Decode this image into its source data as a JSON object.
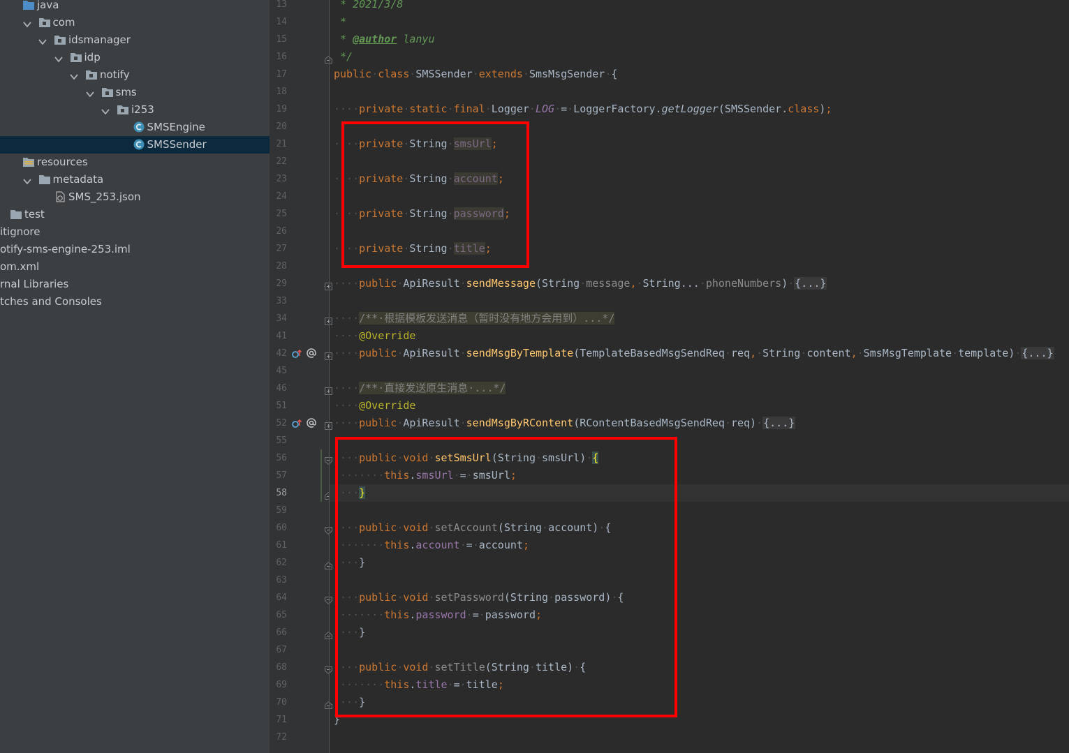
{
  "colors": {
    "tree_background": "#3c3f41",
    "tree_selected": "#0d293e",
    "editor_background": "#2b2b2b",
    "keyword": "#cc7832",
    "field": "#9876aa",
    "method": "#ffc66d",
    "annotation": "#bbb529",
    "doc_comment": "#629755",
    "highlight_box": "#ff0000"
  },
  "tree": {
    "items": [
      {
        "label": "java",
        "icon": "source-folder-icon",
        "arrow": false,
        "indent": 0
      },
      {
        "label": "com",
        "icon": "package-icon",
        "arrow": true,
        "indent": 1
      },
      {
        "label": "idsmanager",
        "icon": "package-icon",
        "arrow": true,
        "indent": 2
      },
      {
        "label": "idp",
        "icon": "package-icon",
        "arrow": true,
        "indent": 3
      },
      {
        "label": "notify",
        "icon": "package-icon",
        "arrow": true,
        "indent": 4
      },
      {
        "label": "sms",
        "icon": "package-icon",
        "arrow": true,
        "indent": 5
      },
      {
        "label": "i253",
        "icon": "package-icon",
        "arrow": true,
        "indent": 6
      },
      {
        "label": "SMSEngine",
        "icon": "java-class-icon",
        "arrow": false,
        "indent": 7
      },
      {
        "label": "SMSSender",
        "icon": "java-class-icon",
        "arrow": false,
        "indent": 7,
        "selected": true
      },
      {
        "label": "resources",
        "icon": "resources-folder-icon",
        "arrow": false,
        "indent": 0
      },
      {
        "label": "metadata",
        "icon": "folder-icon",
        "arrow": true,
        "indent": 1
      },
      {
        "label": "SMS_253.json",
        "icon": "json-file-icon",
        "arrow": false,
        "indent": 2
      },
      {
        "label": "test",
        "icon": "folder-icon",
        "arrow": false,
        "indent": -1
      },
      {
        "label": "itignore",
        "icon": "",
        "arrow": false,
        "indent": -2
      },
      {
        "label": "otify-sms-engine-253.iml",
        "icon": "",
        "arrow": false,
        "indent": -2
      },
      {
        "label": "om.xml",
        "icon": "",
        "arrow": false,
        "indent": -2
      },
      {
        "label": "rnal Libraries",
        "icon": "",
        "arrow": false,
        "indent": -2
      },
      {
        "label": "tches and Consoles",
        "icon": "",
        "arrow": false,
        "indent": -2
      }
    ]
  },
  "editor": {
    "current_line": "58",
    "lines": [
      {
        "n": "13",
        "tokens": [
          [
            "cm",
            " * 2021/3/8"
          ]
        ]
      },
      {
        "n": "14",
        "tokens": [
          [
            "cm",
            " *"
          ]
        ]
      },
      {
        "n": "15",
        "tokens": [
          [
            "cm",
            " * "
          ],
          [
            "tag",
            "@author"
          ],
          [
            "cm",
            " lanyu"
          ]
        ]
      },
      {
        "n": "16",
        "tokens": [
          [
            "cm",
            " */"
          ]
        ],
        "fold": "end"
      },
      {
        "n": "17",
        "tokens": [
          [
            "kw",
            "public"
          ],
          [
            "dot",
            "·"
          ],
          [
            "kw",
            "class"
          ],
          [
            "dot",
            "·"
          ],
          [
            "",
            "SMSSender"
          ],
          [
            "dot",
            "·"
          ],
          [
            "kw",
            "extends"
          ],
          [
            "dot",
            "·"
          ],
          [
            "",
            "SmsMsgSender"
          ],
          [
            "dot",
            "·"
          ],
          [
            "",
            "{"
          ]
        ]
      },
      {
        "n": "18",
        "tokens": []
      },
      {
        "n": "19",
        "tokens": [
          [
            "dot",
            "····"
          ],
          [
            "kw",
            "private"
          ],
          [
            "dot",
            "·"
          ],
          [
            "kw",
            "static"
          ],
          [
            "dot",
            "·"
          ],
          [
            "kw",
            "final"
          ],
          [
            "dot",
            "·"
          ],
          [
            "",
            "Logger"
          ],
          [
            "dot",
            "·"
          ],
          [
            "fld-i",
            "LOG"
          ],
          [
            "dot",
            "·"
          ],
          [
            "",
            "="
          ],
          [
            "dot",
            "·"
          ],
          [
            "",
            "LoggerFactory."
          ],
          [
            "fn-i",
            "getLogger"
          ],
          [
            "",
            "(SMSSender."
          ],
          [
            "kw",
            "class"
          ],
          [
            "",
            ")"
          ],
          [
            "kw",
            ";"
          ]
        ]
      },
      {
        "n": "20",
        "tokens": []
      },
      {
        "n": "21",
        "tokens": [
          [
            "dot",
            "····"
          ],
          [
            "kw",
            "private"
          ],
          [
            "dot",
            "·"
          ],
          [
            "",
            "String"
          ],
          [
            "dot",
            "·"
          ],
          [
            "unused-fld",
            "smsUrl"
          ],
          [
            "kw",
            ";"
          ]
        ]
      },
      {
        "n": "22",
        "tokens": []
      },
      {
        "n": "23",
        "tokens": [
          [
            "dot",
            "····"
          ],
          [
            "kw",
            "private"
          ],
          [
            "dot",
            "·"
          ],
          [
            "",
            "String"
          ],
          [
            "dot",
            "·"
          ],
          [
            "unused-fld",
            "account"
          ],
          [
            "kw",
            ";"
          ]
        ]
      },
      {
        "n": "24",
        "tokens": []
      },
      {
        "n": "25",
        "tokens": [
          [
            "dot",
            "····"
          ],
          [
            "kw",
            "private"
          ],
          [
            "dot",
            "·"
          ],
          [
            "",
            "String"
          ],
          [
            "dot",
            "·"
          ],
          [
            "unused-fld",
            "password"
          ],
          [
            "kw",
            ";"
          ]
        ]
      },
      {
        "n": "26",
        "tokens": []
      },
      {
        "n": "27",
        "tokens": [
          [
            "dot",
            "····"
          ],
          [
            "kw",
            "private"
          ],
          [
            "dot",
            "·"
          ],
          [
            "",
            "String"
          ],
          [
            "dot",
            "·"
          ],
          [
            "unused-fld",
            "title"
          ],
          [
            "kw",
            ";"
          ]
        ]
      },
      {
        "n": "28",
        "tokens": []
      },
      {
        "n": "29",
        "tokens": [
          [
            "dot",
            "····"
          ],
          [
            "kw",
            "public"
          ],
          [
            "dot",
            "·"
          ],
          [
            "",
            "ApiResult"
          ],
          [
            "dot",
            "·"
          ],
          [
            "fn",
            "sendMessage"
          ],
          [
            "",
            "(String"
          ],
          [
            "dot",
            "·"
          ],
          [
            "param-dim",
            "message"
          ],
          [
            "kw",
            ","
          ],
          [
            "dot",
            "·"
          ],
          [
            "",
            "String..."
          ],
          [
            "dot",
            "·"
          ],
          [
            "param-dim",
            "phoneNumbers"
          ],
          [
            "",
            ")"
          ],
          [
            "dot",
            "·"
          ],
          [
            "fold-ph",
            "{...}"
          ]
        ],
        "fold": "plus"
      },
      {
        "n": "33",
        "tokens": []
      },
      {
        "n": "34",
        "tokens": [
          [
            "dot",
            "····"
          ],
          [
            "fold-cm bc",
            "/**·根据模板发送消息（暂时没有地方会用到）...*/"
          ]
        ],
        "fold": "plus"
      },
      {
        "n": "41",
        "tokens": [
          [
            "dot",
            "····"
          ],
          [
            "ann",
            "@Override"
          ]
        ]
      },
      {
        "n": "42",
        "tokens": [
          [
            "dot",
            "····"
          ],
          [
            "kw",
            "public"
          ],
          [
            "dot",
            "·"
          ],
          [
            "",
            "ApiResult"
          ],
          [
            "dot",
            "·"
          ],
          [
            "fn",
            "sendMsgByTemplate"
          ],
          [
            "",
            "(TemplateBasedMsgSendReq"
          ],
          [
            "dot",
            "·"
          ],
          [
            "",
            "req"
          ],
          [
            "kw",
            ","
          ],
          [
            "dot",
            "·"
          ],
          [
            "",
            "String"
          ],
          [
            "dot",
            "·"
          ],
          [
            "",
            "content"
          ],
          [
            "kw",
            ","
          ],
          [
            "dot",
            "·"
          ],
          [
            "",
            "SmsMsgTemplate"
          ],
          [
            "dot",
            "·"
          ],
          [
            "",
            "template)"
          ],
          [
            "dot",
            "·"
          ],
          [
            "fold-ph",
            "{...}"
          ]
        ],
        "fold": "plus",
        "marks": true
      },
      {
        "n": "45",
        "tokens": []
      },
      {
        "n": "46",
        "tokens": [
          [
            "dot",
            "····"
          ],
          [
            "fold-cm bc",
            "/**·直接发送原生消息·...*/"
          ]
        ],
        "fold": "plus"
      },
      {
        "n": "51",
        "tokens": [
          [
            "dot",
            "····"
          ],
          [
            "ann",
            "@Override"
          ]
        ]
      },
      {
        "n": "52",
        "tokens": [
          [
            "dot",
            "····"
          ],
          [
            "kw",
            "public"
          ],
          [
            "dot",
            "·"
          ],
          [
            "",
            "ApiResult"
          ],
          [
            "dot",
            "·"
          ],
          [
            "fn",
            "sendMsgByRContent"
          ],
          [
            "",
            "(RContentBasedMsgSendReq"
          ],
          [
            "dot",
            "·"
          ],
          [
            "",
            "req)"
          ],
          [
            "dot",
            "·"
          ],
          [
            "fold-ph",
            "{...}"
          ]
        ],
        "fold": "plus",
        "marks": true
      },
      {
        "n": "55",
        "tokens": []
      },
      {
        "n": "56",
        "tokens": [
          [
            "dot",
            "····"
          ],
          [
            "kw",
            "public"
          ],
          [
            "dot",
            "·"
          ],
          [
            "kw",
            "void"
          ],
          [
            "dot",
            "·"
          ],
          [
            "fn",
            "setSmsUrl"
          ],
          [
            "",
            "(String"
          ],
          [
            "dot",
            "·"
          ],
          [
            "",
            "smsUrl)"
          ],
          [
            "dot",
            "·"
          ],
          [
            "brace-hl",
            "{"
          ]
        ],
        "fold": "start"
      },
      {
        "n": "57",
        "tokens": [
          [
            "dot",
            "········"
          ],
          [
            "kw",
            "this"
          ],
          [
            "",
            "."
          ],
          [
            "fld",
            "smsUrl"
          ],
          [
            "dot",
            "·"
          ],
          [
            "",
            "="
          ],
          [
            "dot",
            "·"
          ],
          [
            "",
            "smsUrl"
          ],
          [
            "kw",
            ";"
          ]
        ]
      },
      {
        "n": "58",
        "tokens": [
          [
            "dot",
            "····"
          ],
          [
            "brace-hl",
            "}"
          ]
        ],
        "fold": "end"
      },
      {
        "n": "59",
        "tokens": []
      },
      {
        "n": "60",
        "tokens": [
          [
            "dot",
            "····"
          ],
          [
            "kw",
            "public"
          ],
          [
            "dot",
            "·"
          ],
          [
            "kw",
            "void"
          ],
          [
            "dot",
            "·"
          ],
          [
            "unused-fn",
            "setAccount"
          ],
          [
            "",
            "(String"
          ],
          [
            "dot",
            "·"
          ],
          [
            "",
            "account)"
          ],
          [
            "dot",
            "·"
          ],
          [
            "",
            "{"
          ]
        ],
        "fold": "start"
      },
      {
        "n": "61",
        "tokens": [
          [
            "dot",
            "········"
          ],
          [
            "kw",
            "this"
          ],
          [
            "",
            "."
          ],
          [
            "fld",
            "account"
          ],
          [
            "dot",
            "·"
          ],
          [
            "",
            "="
          ],
          [
            "dot",
            "·"
          ],
          [
            "",
            "account"
          ],
          [
            "kw",
            ";"
          ]
        ]
      },
      {
        "n": "62",
        "tokens": [
          [
            "dot",
            "····"
          ],
          [
            "",
            "}"
          ]
        ],
        "fold": "end"
      },
      {
        "n": "63",
        "tokens": []
      },
      {
        "n": "64",
        "tokens": [
          [
            "dot",
            "····"
          ],
          [
            "kw",
            "public"
          ],
          [
            "dot",
            "·"
          ],
          [
            "kw",
            "void"
          ],
          [
            "dot",
            "·"
          ],
          [
            "unused-fn",
            "setPassword"
          ],
          [
            "",
            "(String"
          ],
          [
            "dot",
            "·"
          ],
          [
            "",
            "password)"
          ],
          [
            "dot",
            "·"
          ],
          [
            "",
            "{"
          ]
        ],
        "fold": "start"
      },
      {
        "n": "65",
        "tokens": [
          [
            "dot",
            "········"
          ],
          [
            "kw",
            "this"
          ],
          [
            "",
            "."
          ],
          [
            "fld",
            "password"
          ],
          [
            "dot",
            "·"
          ],
          [
            "",
            "="
          ],
          [
            "dot",
            "·"
          ],
          [
            "",
            "password"
          ],
          [
            "kw",
            ";"
          ]
        ]
      },
      {
        "n": "66",
        "tokens": [
          [
            "dot",
            "····"
          ],
          [
            "",
            "}"
          ]
        ],
        "fold": "end"
      },
      {
        "n": "67",
        "tokens": []
      },
      {
        "n": "68",
        "tokens": [
          [
            "dot",
            "····"
          ],
          [
            "kw",
            "public"
          ],
          [
            "dot",
            "·"
          ],
          [
            "kw",
            "void"
          ],
          [
            "dot",
            "·"
          ],
          [
            "unused-fn",
            "setTitle"
          ],
          [
            "",
            "(String"
          ],
          [
            "dot",
            "·"
          ],
          [
            "",
            "title)"
          ],
          [
            "dot",
            "·"
          ],
          [
            "",
            "{"
          ]
        ],
        "fold": "start"
      },
      {
        "n": "69",
        "tokens": [
          [
            "dot",
            "········"
          ],
          [
            "kw",
            "this"
          ],
          [
            "",
            "."
          ],
          [
            "fld",
            "title"
          ],
          [
            "dot",
            "·"
          ],
          [
            "",
            "="
          ],
          [
            "dot",
            "·"
          ],
          [
            "",
            "title"
          ],
          [
            "kw",
            ";"
          ]
        ]
      },
      {
        "n": "70",
        "tokens": [
          [
            "dot",
            "····"
          ],
          [
            "",
            "}"
          ]
        ],
        "fold": "end"
      },
      {
        "n": "71",
        "tokens": [
          [
            "",
            "}"
          ]
        ]
      },
      {
        "n": "72",
        "tokens": []
      }
    ]
  }
}
